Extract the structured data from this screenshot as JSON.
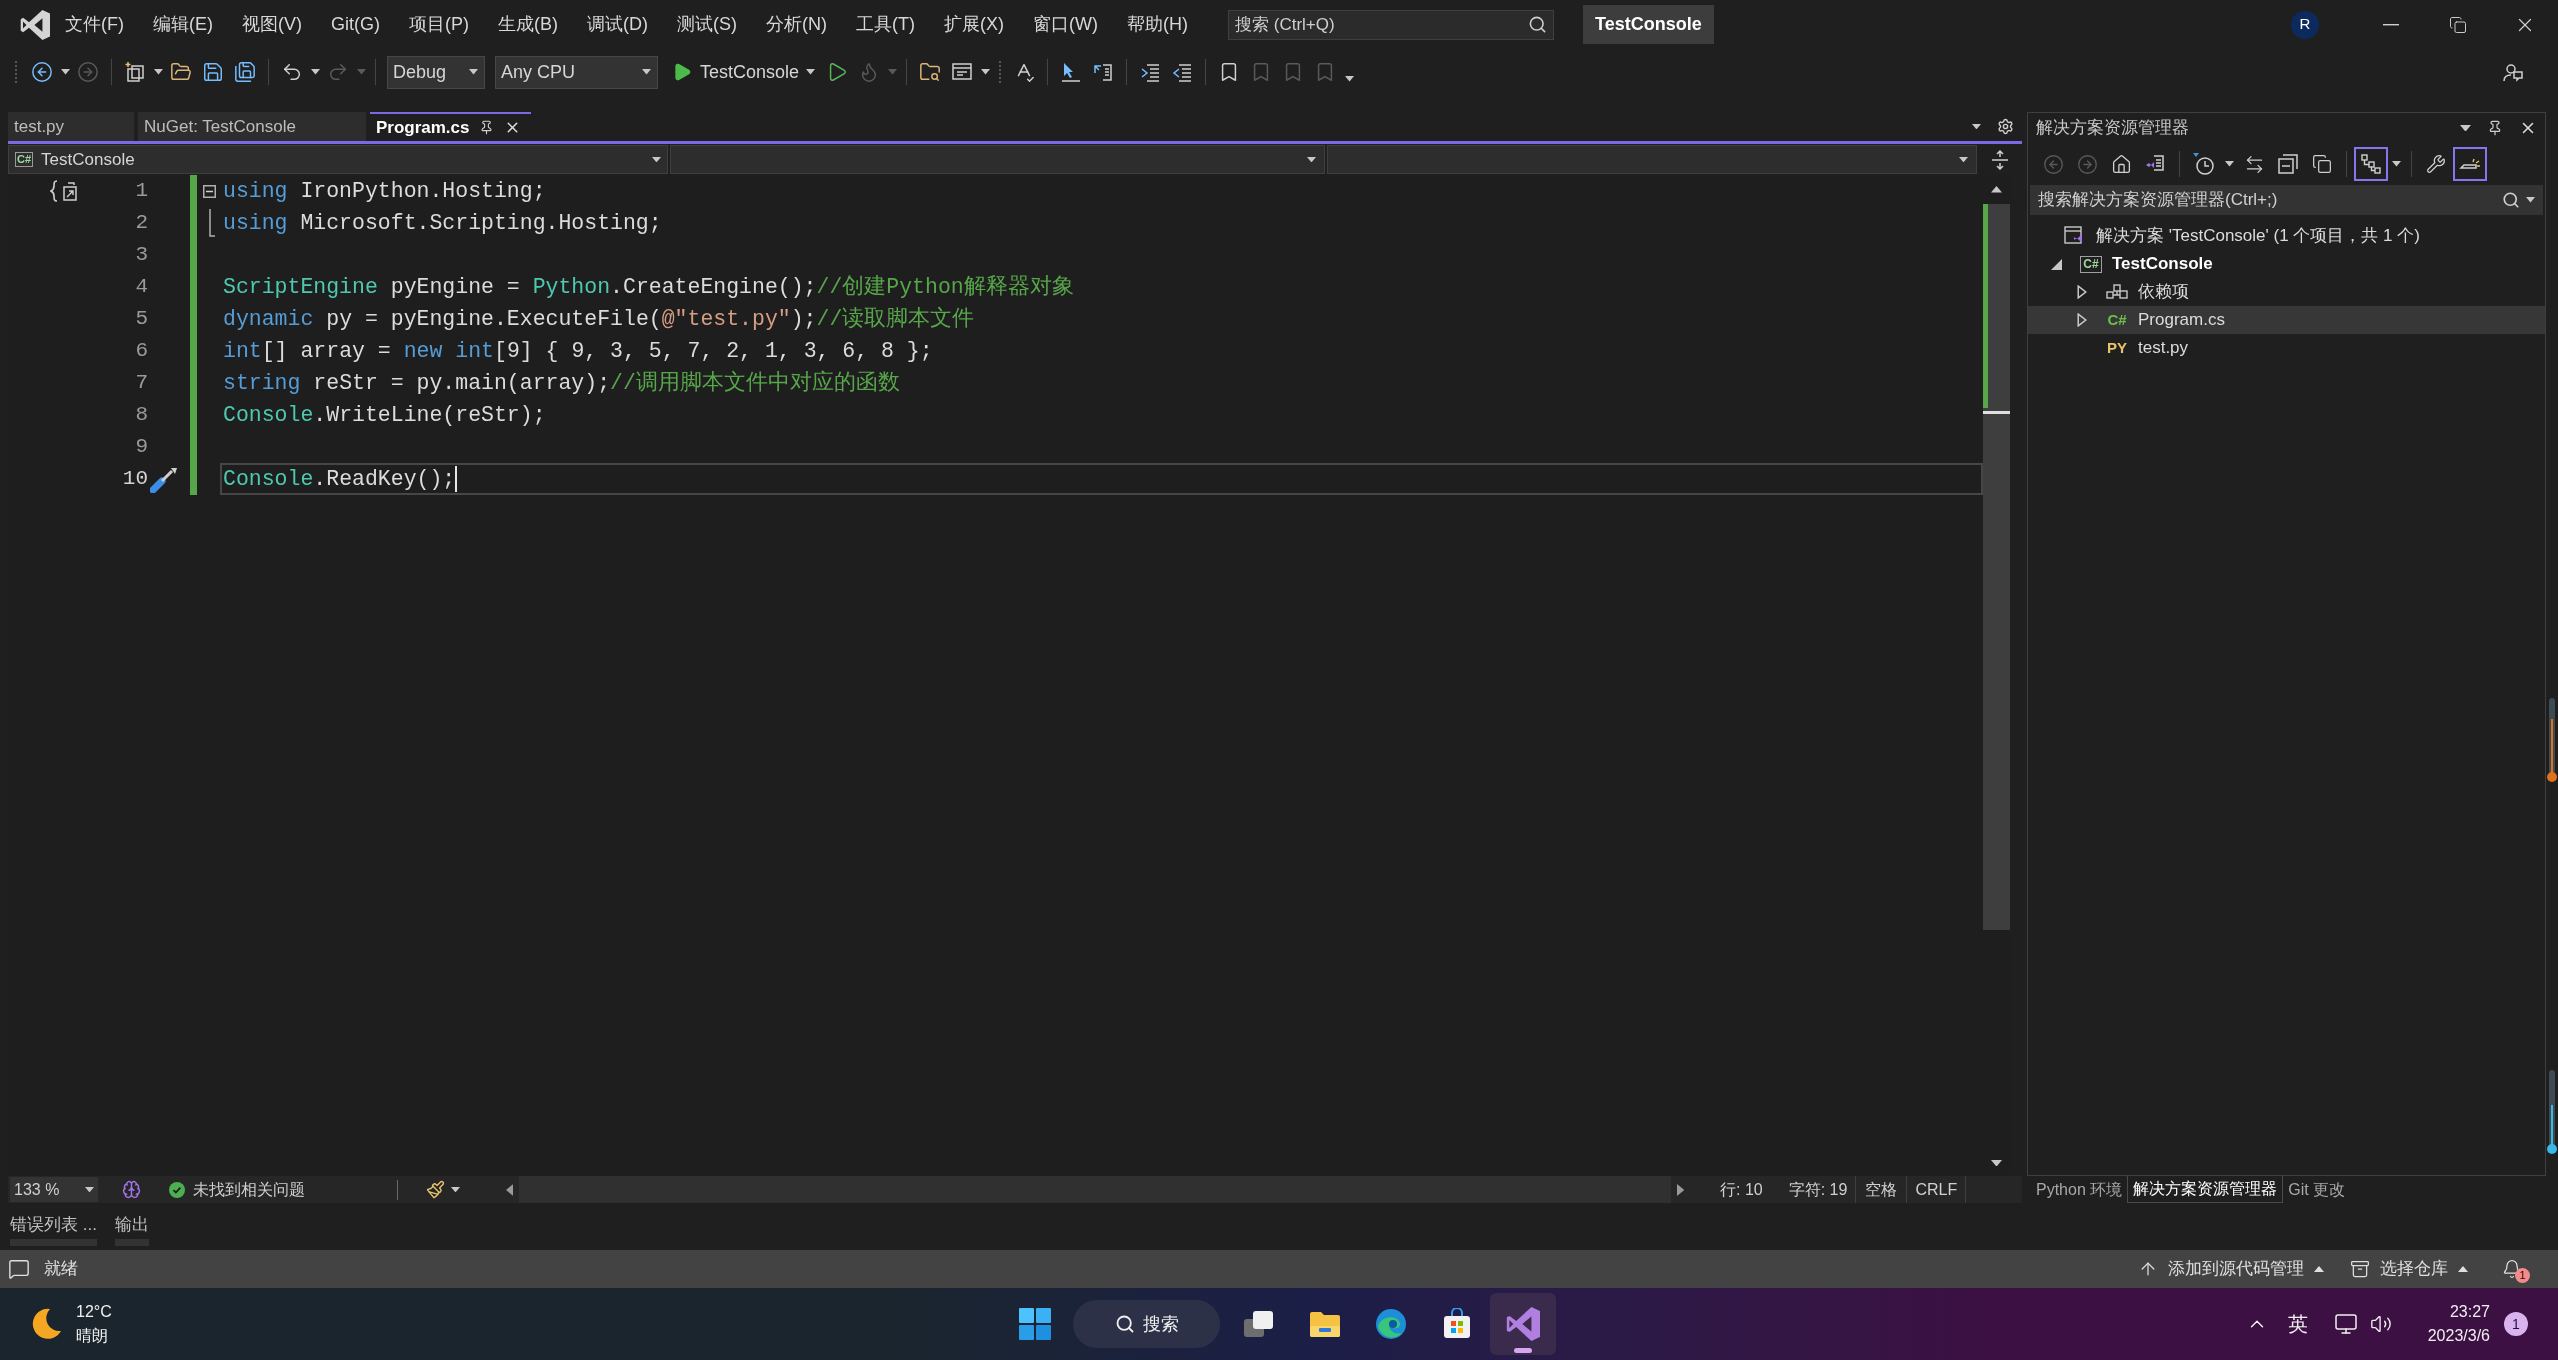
{
  "window": {
    "title": "TestConsole",
    "search": {
      "placeholder": "搜索 (Ctrl+Q)"
    },
    "account": "R"
  },
  "menu": [
    "文件(F)",
    "编辑(E)",
    "视图(V)",
    "Git(G)",
    "项目(P)",
    "生成(B)",
    "调试(D)",
    "测试(S)",
    "分析(N)",
    "工具(T)",
    "扩展(X)",
    "窗口(W)",
    "帮助(H)"
  ],
  "toolbar": {
    "left_buttons": [
      {
        "disabled": false
      },
      {
        "disabled": true
      },
      {
        "disabled": false
      },
      {
        "disabled": false
      },
      {
        "disabled": false
      },
      {
        "disabled": false
      },
      {
        "disabled": false
      },
      {
        "disabled": true
      }
    ],
    "configuration": "Debug",
    "platform": "Any CPU",
    "start": "TestConsole",
    "right_buttons": [
      {
        "disabled": false
      },
      {
        "disabled": true
      },
      {
        "disabled": false
      },
      {
        "disabled": false
      },
      {
        "disabled": false
      },
      {
        "disabled": false
      },
      {
        "disabled": false
      },
      {
        "disabled": false
      },
      {
        "disabled": false
      },
      {
        "disabled": false
      },
      {
        "disabled": true
      },
      {
        "disabled": true
      },
      {
        "disabled": true
      }
    ]
  },
  "editor_tabs": [
    {
      "label": "test.py",
      "selected": false
    },
    {
      "label": "NuGet: TestConsole",
      "selected": false
    },
    {
      "label": "Program.cs",
      "selected": true
    }
  ],
  "navigation_bar": {
    "project": "TestConsole",
    "icon_label": "C#"
  },
  "code": {
    "saved_changes": true,
    "lines": [
      {
        "number": "1",
        "current": false,
        "fold_start": true,
        "fold_end": false,
        "tokens": [
          {
            "text": "using",
            "kind": "keyword"
          },
          {
            "text": " IronPython.Hosting;",
            "kind": "plain"
          }
        ]
      },
      {
        "number": "2",
        "current": false,
        "fold_start": false,
        "fold_end": true,
        "tokens": [
          {
            "text": "using",
            "kind": "keyword"
          },
          {
            "text": " Microsoft.Scripting.Hosting;",
            "kind": "plain"
          }
        ]
      },
      {
        "number": "3",
        "current": false,
        "fold_start": false,
        "fold_end": false
      },
      {
        "number": "4",
        "current": false,
        "fold_start": false,
        "fold_end": false,
        "tokens": [
          {
            "text": "ScriptEngine",
            "kind": "type"
          },
          {
            "text": " pyEngine = ",
            "kind": "plain"
          },
          {
            "text": "Python",
            "kind": "type"
          },
          {
            "text": ".CreateEngine();",
            "kind": "plain"
          },
          {
            "text": "//创建Python解释器对象",
            "kind": "comment"
          }
        ]
      },
      {
        "number": "5",
        "current": false,
        "fold_start": false,
        "fold_end": false,
        "tokens": [
          {
            "text": "dynamic",
            "kind": "keyword"
          },
          {
            "text": " py = pyEngine.ExecuteFile(",
            "kind": "plain"
          },
          {
            "text": "@\"test.py\"",
            "kind": "string"
          },
          {
            "text": ");",
            "kind": "plain"
          },
          {
            "text": "//读取脚本文件",
            "kind": "comment"
          }
        ]
      },
      {
        "number": "6",
        "current": false,
        "fold_start": false,
        "fold_end": false,
        "tokens": [
          {
            "text": "int",
            "kind": "keyword"
          },
          {
            "text": "[] array = ",
            "kind": "plain"
          },
          {
            "text": "new int",
            "kind": "keyword"
          },
          {
            "text": "[9] { 9, 3, 5, 7, 2, 1, 3, 6, 8 };",
            "kind": "plain"
          }
        ]
      },
      {
        "number": "7",
        "current": false,
        "fold_start": false,
        "fold_end": false,
        "tokens": [
          {
            "text": "string",
            "kind": "keyword"
          },
          {
            "text": " reStr = py.main(array);",
            "kind": "plain"
          },
          {
            "text": "//调用脚本文件中对应的函数",
            "kind": "comment"
          }
        ]
      },
      {
        "number": "8",
        "current": false,
        "fold_start": false,
        "fold_end": false,
        "tokens": [
          {
            "text": "Console",
            "kind": "type"
          },
          {
            "text": ".WriteLine(reStr);",
            "kind": "plain"
          }
        ]
      },
      {
        "number": "9",
        "current": false,
        "fold_start": false,
        "fold_end": false
      },
      {
        "number": "10",
        "current": true,
        "fold_start": false,
        "fold_end": false,
        "tokens": [
          {
            "text": "Console",
            "kind": "type"
          },
          {
            "text": ".ReadKey();",
            "kind": "plain"
          }
        ]
      }
    ]
  },
  "editor_status": {
    "zoom": "133 %",
    "issues": "未找到相关问题",
    "line": "行: 10",
    "column": "字符: 19",
    "indent": "空格",
    "line_ending": "CRLF"
  },
  "solution_explorer": {
    "title": "解决方案资源管理器",
    "toolbar": [
      {
        "disabled": true,
        "on": false
      },
      {
        "disabled": true,
        "on": false
      },
      {
        "disabled": false,
        "on": false
      },
      {
        "disabled": false,
        "on": false
      },
      {
        "disabled": false,
        "on": false
      },
      {
        "disabled": false,
        "on": false
      },
      {
        "disabled": false,
        "on": false
      },
      {
        "disabled": false,
        "on": false
      },
      {
        "disabled": false,
        "on": true
      },
      {
        "disabled": false,
        "on": false
      },
      {
        "disabled": false,
        "on": true
      }
    ],
    "search": {
      "placeholder": "搜索解决方案资源管理器(Ctrl+;)"
    },
    "tree": [
      {
        "label": "解决方案 'TestConsole' (1 个项目，共 1 个)",
        "kind": "solution",
        "selected": false,
        "startup": false,
        "children": [
          {
            "label": "TestConsole",
            "kind": "project",
            "icon_label": "C#",
            "expanded": true,
            "selected": false,
            "startup": true,
            "children": [
              {
                "label": "依赖项",
                "kind": "dependencies",
                "expanded": false,
                "selected": false,
                "startup": false
              },
              {
                "label": "Program.cs",
                "kind": "csharp",
                "icon_label": "C#",
                "expanded": false,
                "selected": true,
                "startup": false
              },
              {
                "label": "test.py",
                "kind": "python",
                "icon_label": "PY",
                "selected": false,
                "startup": false
              }
            ]
          }
        ]
      }
    ],
    "tabs": [
      {
        "label": "Python 环境",
        "selected": false
      },
      {
        "label": "解决方案资源管理器",
        "selected": true
      },
      {
        "label": "Git 更改",
        "selected": false
      }
    ]
  },
  "edge_gauges": [
    {
      "level": 0.72,
      "color": "#e0701c"
    },
    {
      "level": 0.54,
      "color": "#3ab8e8"
    }
  ],
  "tool_tabs": [
    {
      "label": "错误列表 ...",
      "selected": false
    },
    {
      "label": "输出",
      "selected": false
    }
  ],
  "status_bar": {
    "message": "就绪",
    "source_control": "添加到源代码管理",
    "repository": "选择仓库",
    "notifications": "1"
  },
  "taskbar": {
    "weather": {
      "temperature": "12°C",
      "condition": "晴朗"
    },
    "search": {
      "label": "搜索"
    },
    "apps": [
      {
        "active": false
      },
      {
        "active": false
      },
      {
        "active": false
      },
      {
        "active": false
      },
      {
        "active": true
      }
    ],
    "language": "英",
    "time": "23:27",
    "date": "2023/3/6",
    "notifications": "1"
  }
}
